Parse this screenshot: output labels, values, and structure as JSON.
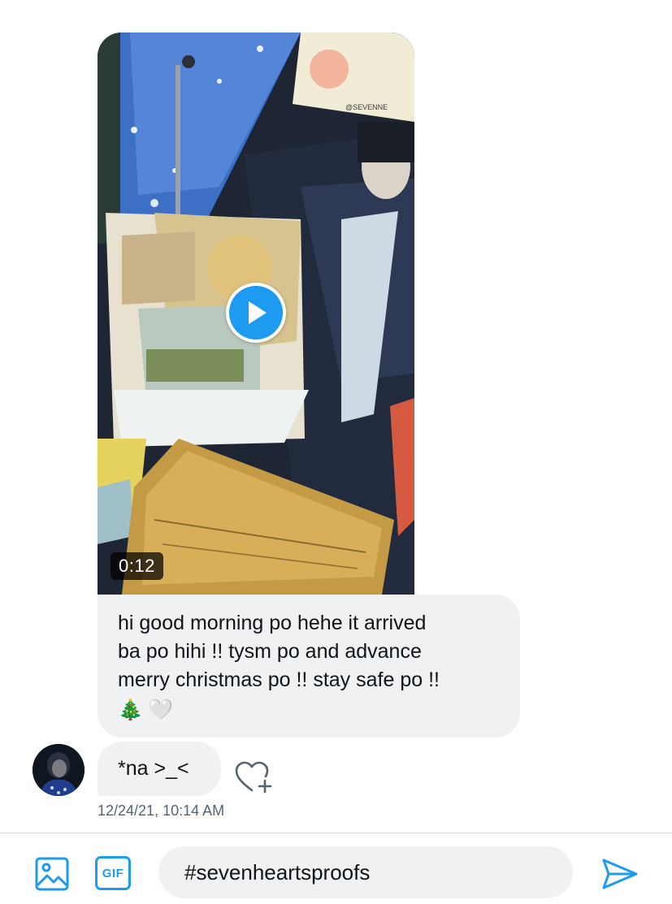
{
  "video": {
    "duration": "0:12",
    "watermark_text": "@SEVENNE"
  },
  "messages": {
    "first_lines": [
      "hi good morning po hehe it arrived",
      "ba po hihi !! tysm po and advance",
      "merry christmas po !! stay safe po !!"
    ],
    "first_emojis": [
      "🎄",
      "🤍"
    ],
    "second": "*na >_<",
    "timestamp": "12/24/21, 10:14 AM"
  },
  "composer": {
    "gif_label": "GIF",
    "input_value": "#sevenheartsproofs"
  },
  "icons": {
    "media": "image-icon",
    "gif": "gif-icon",
    "send": "send-icon",
    "react": "heart-plus-icon",
    "play": "play-icon"
  },
  "colors": {
    "accent": "#1d9bf0",
    "bubble": "#eff1f3",
    "text": "#0f1419",
    "muted": "#536471"
  }
}
